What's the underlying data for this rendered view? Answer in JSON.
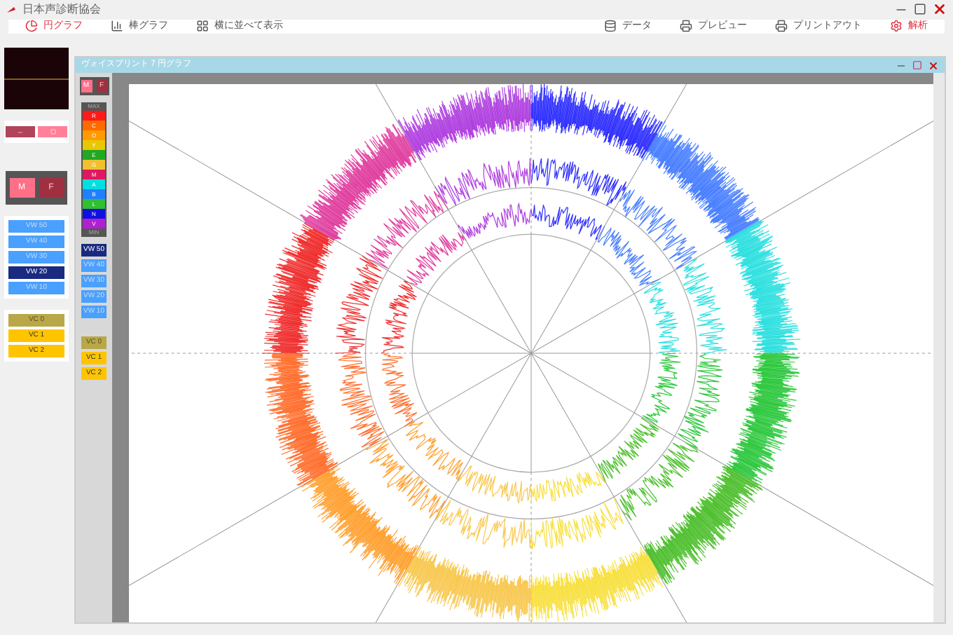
{
  "app": {
    "title": "日本声診断協会"
  },
  "toolbar": {
    "left": [
      {
        "label": "円グラフ",
        "selected": true,
        "kind": "pie"
      },
      {
        "label": "棒グラフ",
        "selected": false,
        "kind": "bar"
      },
      {
        "label": "横に並べて表示",
        "selected": false,
        "kind": "grid"
      }
    ],
    "right": [
      {
        "label": "データ",
        "kind": "data",
        "selected": false
      },
      {
        "label": "プレビュー",
        "kind": "print",
        "selected": false
      },
      {
        "label": "プリントアウト",
        "kind": "print",
        "selected": false
      },
      {
        "label": "解析",
        "kind": "analyze",
        "selected": true
      }
    ]
  },
  "sidebar": {
    "gender": [
      {
        "label": "M",
        "selected": true
      },
      {
        "label": "F",
        "selected": false
      }
    ],
    "vw": [
      {
        "label": "VW 50",
        "selected": false
      },
      {
        "label": "VW 40",
        "selected": false
      },
      {
        "label": "VW 30",
        "selected": false
      },
      {
        "label": "VW 20",
        "selected": true
      },
      {
        "label": "VW 10",
        "selected": false
      }
    ],
    "vc": [
      {
        "label": "VC 0",
        "selected": true
      },
      {
        "label": "VC 1",
        "selected": false
      },
      {
        "label": "VC 2",
        "selected": false
      }
    ]
  },
  "window": {
    "title": "ヴォイスプリント 7 円グラフ",
    "gender": [
      {
        "label": "M",
        "selected": true
      },
      {
        "label": "F",
        "selected": false
      }
    ],
    "max_label": "MAX",
    "min_label": "MIN",
    "tones": [
      {
        "label": "R",
        "color": "#ff1a1a"
      },
      {
        "label": "C",
        "color": "#ff6a00"
      },
      {
        "label": "O",
        "color": "#ff9a00"
      },
      {
        "label": "Y",
        "color": "#e8c800"
      },
      {
        "label": "E",
        "color": "#22a822"
      },
      {
        "label": "G",
        "color": "#f0c030"
      },
      {
        "label": "M",
        "color": "#e01860"
      },
      {
        "label": "A",
        "color": "#00e0e0"
      },
      {
        "label": "B",
        "color": "#2080ff"
      },
      {
        "label": "L",
        "color": "#30c030"
      },
      {
        "label": "N",
        "color": "#1010e0"
      },
      {
        "label": "V",
        "color": "#b020d0"
      }
    ],
    "vw": [
      {
        "label": "VW 50",
        "selected": true
      },
      {
        "label": "VW 40",
        "selected": false
      },
      {
        "label": "VW 30",
        "selected": false
      },
      {
        "label": "VW 20",
        "selected": false
      },
      {
        "label": "VW 10",
        "selected": false
      }
    ],
    "vc": [
      {
        "label": "VC 0",
        "selected": true
      },
      {
        "label": "VC 1",
        "selected": false
      },
      {
        "label": "VC 2",
        "selected": false
      }
    ]
  }
}
